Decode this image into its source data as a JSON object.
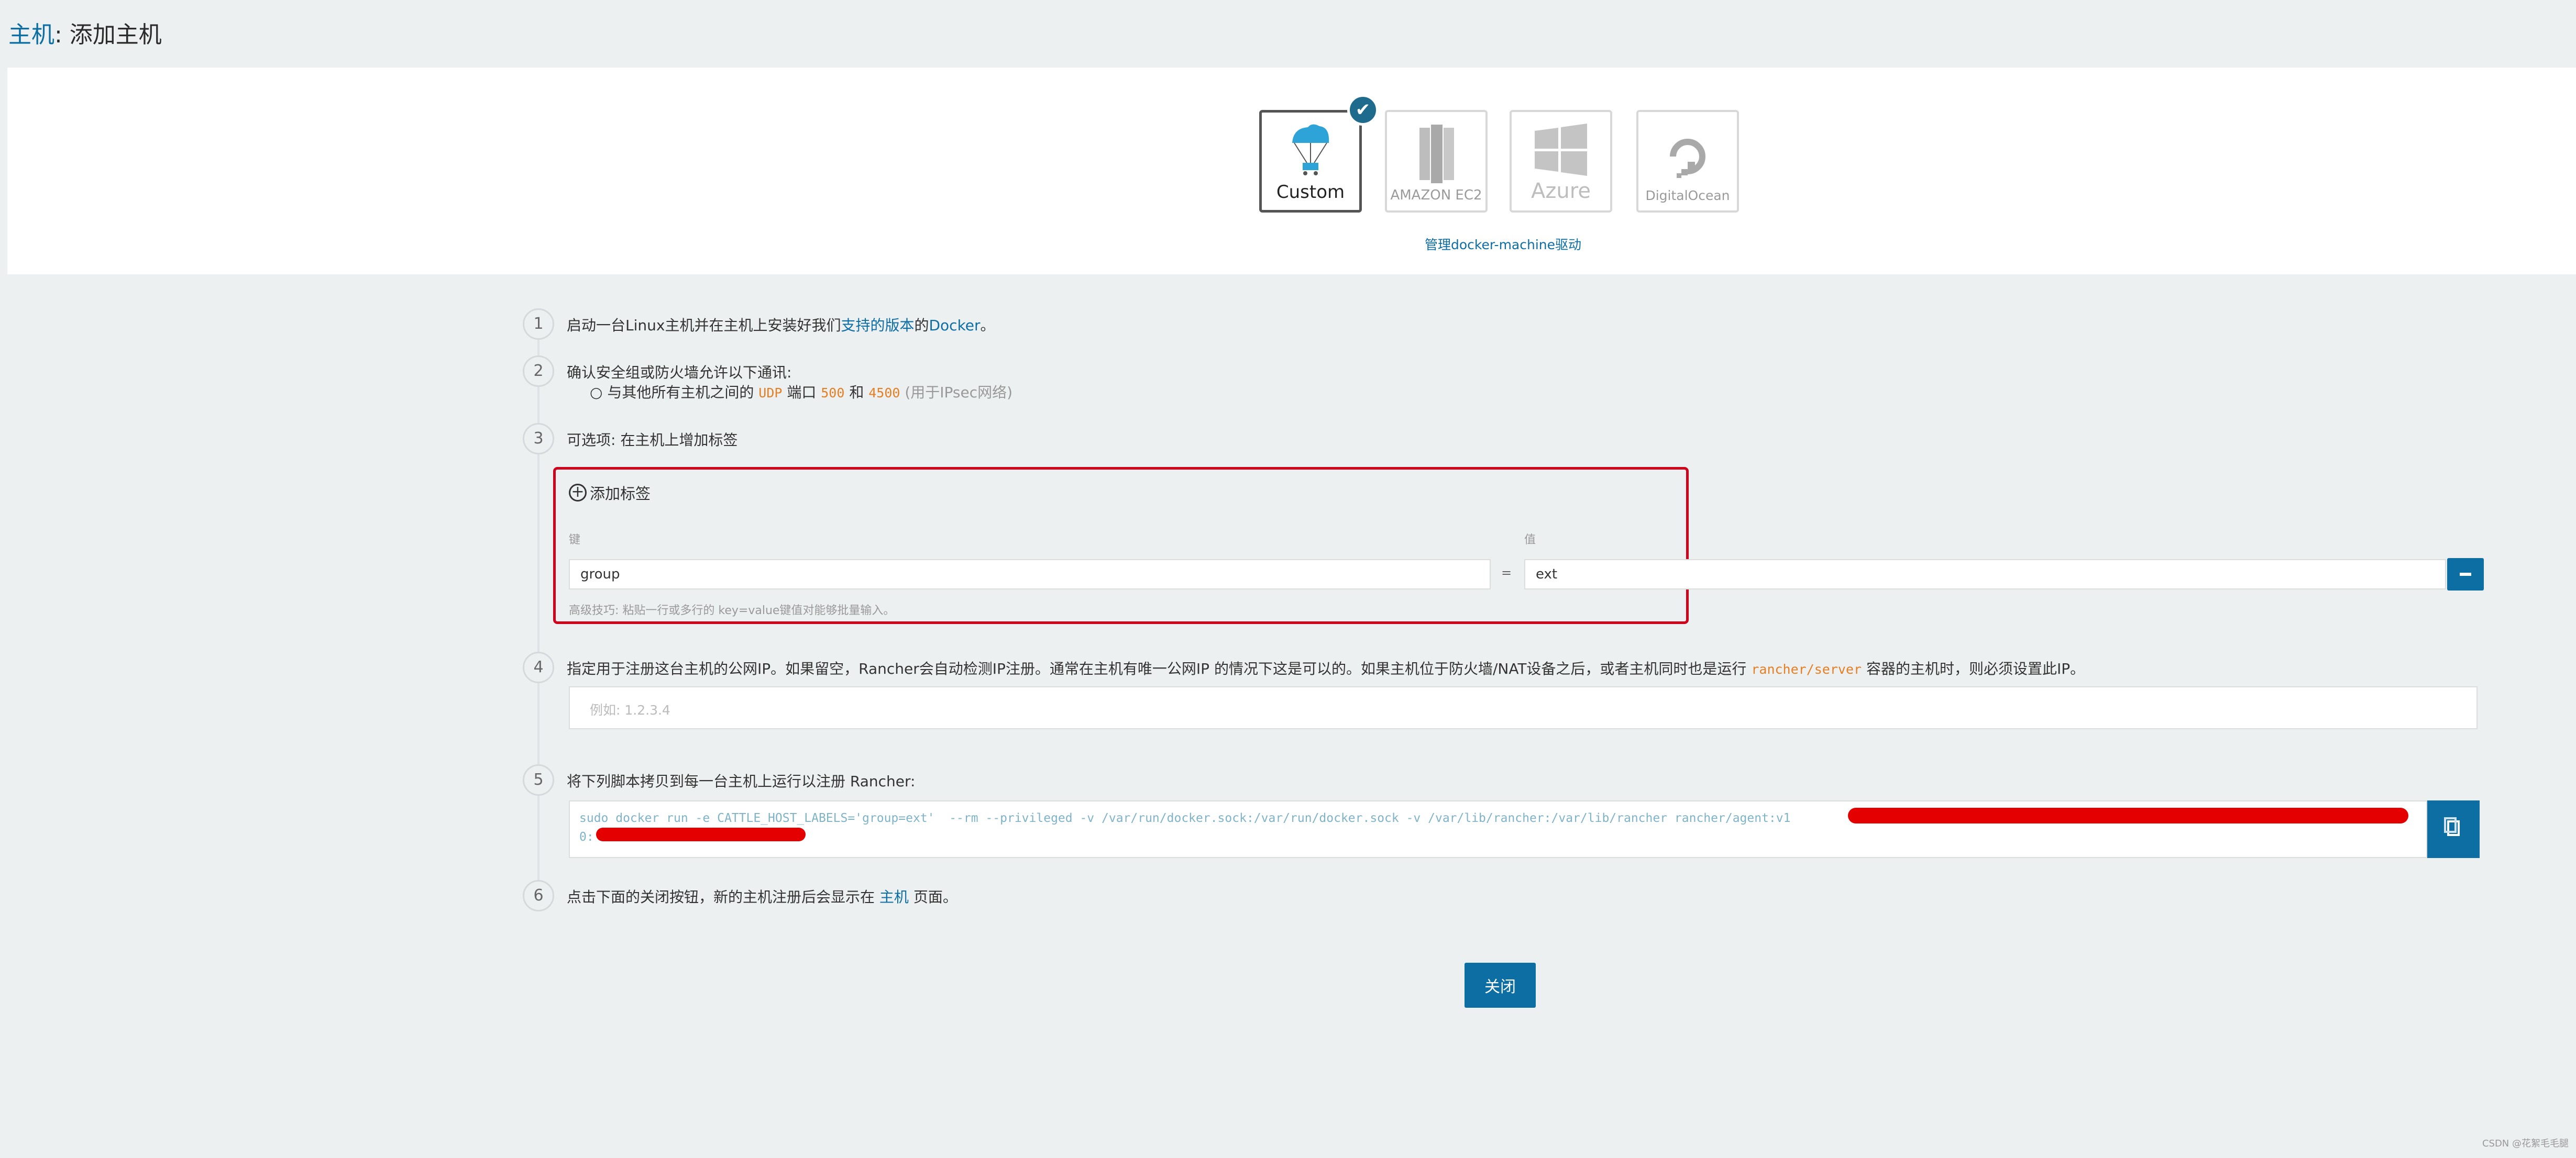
{
  "header": {
    "title_link": "主机",
    "title_rest": ": 添加主机"
  },
  "drivers": {
    "items": [
      {
        "label": "Custom",
        "icon": "parachute-icon",
        "selected": true
      },
      {
        "label": "AMAZON EC2",
        "icon": "amazon-ec2-icon",
        "selected": false
      },
      {
        "label": "Azure",
        "icon": "azure-windows-icon",
        "selected": false
      },
      {
        "label": "DigitalOcean",
        "icon": "digitalocean-icon",
        "selected": false
      }
    ],
    "check_mark": "✔",
    "manage_link": "管理docker-machine驱动"
  },
  "steps": {
    "s1": {
      "num": "1",
      "text_a": "启动一台Linux主机并在主机上安装好我们",
      "link_a": "支持的版本",
      "text_b": "的",
      "link_b": "Docker",
      "text_c": "。"
    },
    "s2": {
      "num": "2",
      "text": "确认安全组或防火墙允许以下通讯:",
      "bullet_a": "与其他所有主机之间的",
      "proto": "UDP",
      "bullet_b": "端口",
      "port_a": "500",
      "bullet_c": "和",
      "port_b": "4500",
      "bullet_note": "(用于IPsec网络)"
    },
    "s3": {
      "num": "3",
      "text": "可选项: 在主机上增加标签",
      "add_label": "添加标签",
      "key_label": "键",
      "value_label": "值",
      "equals": "=",
      "key_value": "group",
      "value_value": "ext",
      "hint": "高级技巧: 粘贴一行或多行的 key=value键值对能够批量输入。"
    },
    "s4": {
      "num": "4",
      "text_a": "指定用于注册这台主机的公网IP。如果留空，Rancher会自动检测IP注册。通常在主机有唯一公网IP 的情况下这是可以的。如果主机位于防火墙/NAT设备之后，或者主机同时也是运行",
      "code": "rancher/server",
      "text_b": "容器的主机时，则必须设置此IP。",
      "placeholder": "例如: 1.2.3.4"
    },
    "s5": {
      "num": "5",
      "text": "将下列脚本拷贝到每一台主机上运行以注册 Rancher:",
      "code_line1": "sudo docker run -e CATTLE_HOST_LABELS='group=ext'  --rm --privileged -v /var/run/docker.sock:/var/run/docker.sock -v /var/lib/rancher:/var/lib/rancher rancher/agent:v1",
      "code_line2": "0:"
    },
    "s6": {
      "num": "6",
      "text_a": "点击下面的关闭按钮，新的主机注册后会显示在",
      "link": "主机",
      "text_b": "页面。"
    }
  },
  "footer": {
    "close_label": "关闭",
    "watermark": "CSDN @花絮毛毛腿"
  },
  "colors": {
    "accent": "#0d6ea4",
    "highlight_border": "#d0021b",
    "redaction": "#e50000",
    "background": "#ecf0f1"
  }
}
